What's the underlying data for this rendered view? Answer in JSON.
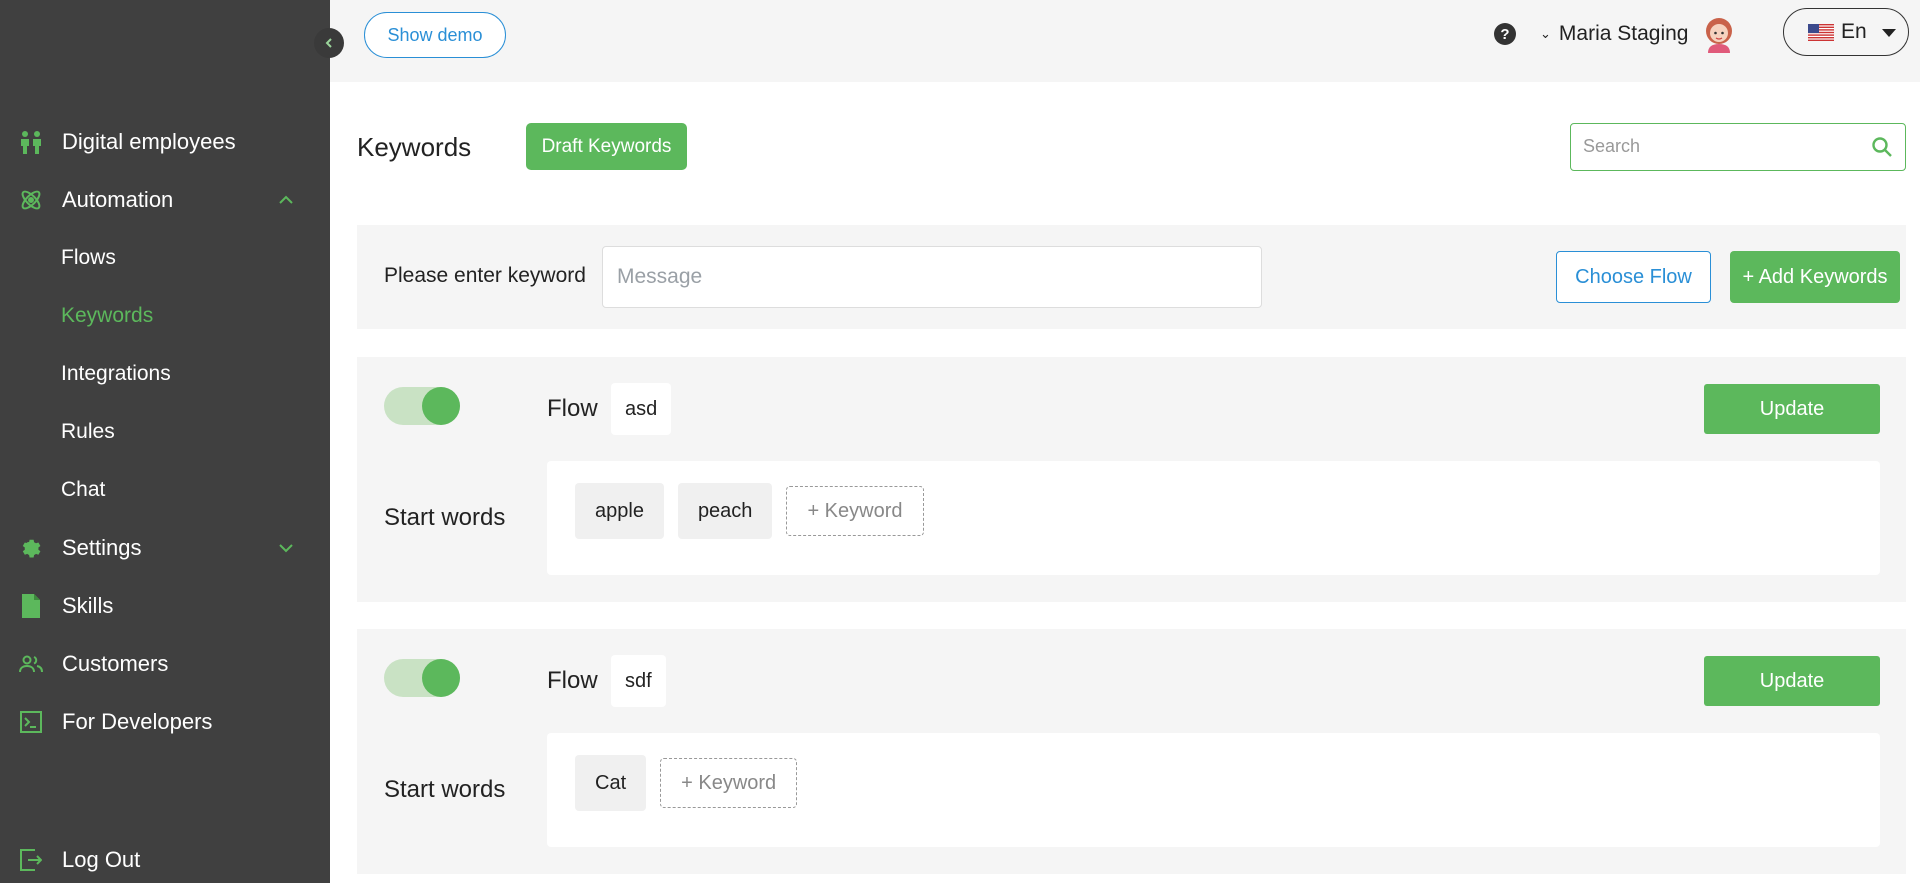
{
  "sidebar": {
    "items": [
      {
        "label": "Digital employees",
        "icon": "people-icon"
      },
      {
        "label": "Automation",
        "icon": "atom-icon",
        "expanded": true
      },
      {
        "label": "Settings",
        "icon": "gear-icon",
        "expanded": false
      },
      {
        "label": "Skills",
        "icon": "file-icon"
      },
      {
        "label": "Customers",
        "icon": "users-icon"
      },
      {
        "label": "For Developers",
        "icon": "terminal-icon"
      }
    ],
    "automation_sub": [
      "Flows",
      "Keywords",
      "Integrations",
      "Rules",
      "Chat"
    ],
    "active_sub": "Keywords",
    "logout_label": "Log Out",
    "accent_color": "#5cb85c"
  },
  "topbar": {
    "demo_label": "Show demo",
    "user_name": "Maria Staging",
    "language": "En"
  },
  "page": {
    "title": "Keywords",
    "draft_label": "Draft Keywords",
    "search_placeholder": "Search"
  },
  "entry": {
    "label": "Please enter keyword",
    "placeholder": "Message",
    "choose_flow_label": "Choose Flow",
    "add_keywords_label": "+ Add Keywords"
  },
  "flows": [
    {
      "flow_label": "Flow",
      "name": "asd",
      "enabled": true,
      "update_label": "Update",
      "start_words_label": "Start words",
      "keywords": [
        "apple",
        "peach"
      ],
      "add_keyword_label": "+ Keyword"
    },
    {
      "flow_label": "Flow",
      "name": "sdf",
      "enabled": true,
      "update_label": "Update",
      "start_words_label": "Start words",
      "keywords": [
        "Cat"
      ],
      "add_keyword_label": "+ Keyword"
    }
  ]
}
